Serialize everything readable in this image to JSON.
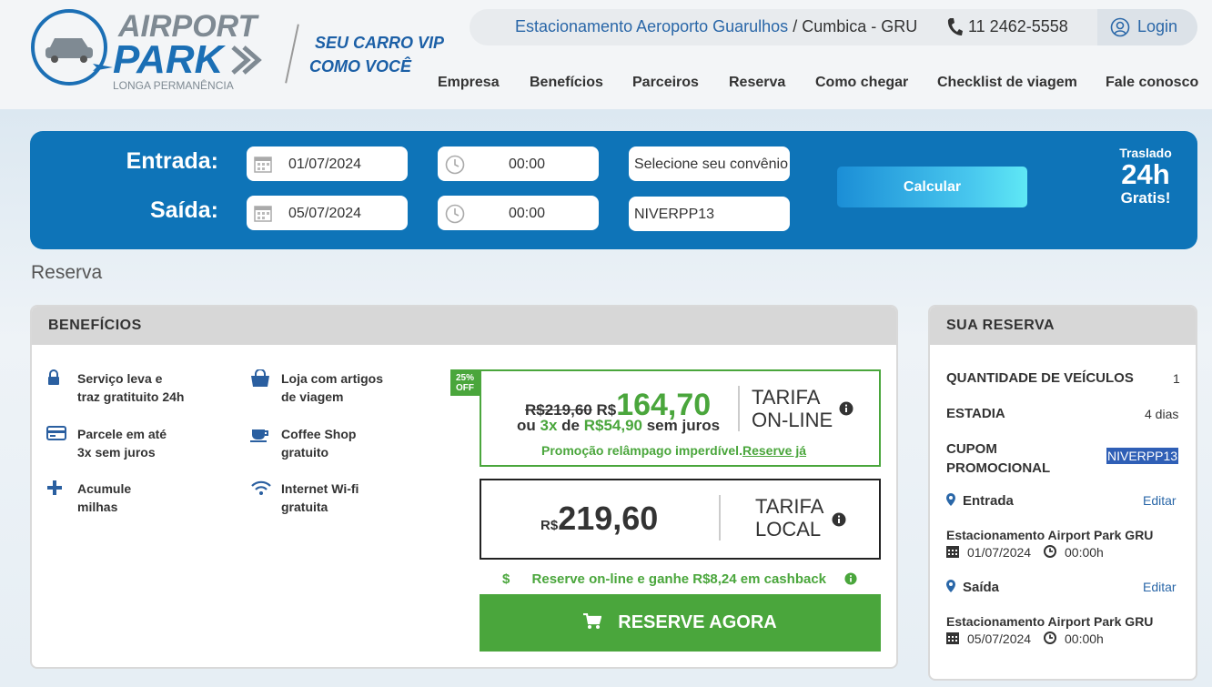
{
  "brand": {
    "logo_top": "AIRPORT",
    "logo_main": "PARK",
    "logo_sub": "LONGA PERMANÊNCIA",
    "slogan_line1": "SEU CARRO VIP",
    "slogan_line2": "COMO VOCÊ"
  },
  "topbar": {
    "location_link": "Estacionamento Aeroporto Guarulhos",
    "location_rest": " / Cumbica - GRU",
    "phone": "11 2462-5558",
    "login": "Login"
  },
  "nav": [
    "Empresa",
    "Benefícios",
    "Parceiros",
    "Reserva",
    "Como chegar",
    "Checklist de viagem",
    "Fale conosco"
  ],
  "form": {
    "entrada_label": "Entrada:",
    "saida_label": "Saída:",
    "entrada_date": "01/07/2024",
    "entrada_time": "00:00",
    "saida_date": "05/07/2024",
    "saida_time": "00:00",
    "convenio_placeholder": "Selecione seu convênio",
    "coupon": "NIVERPP13",
    "calc_button": "Calcular",
    "traslado_top": "Traslado",
    "traslado_mid": "24h",
    "traslado_bot": "Gratis!"
  },
  "page_title": "Reserva",
  "benefits": {
    "title": "BENEFÍCIOS",
    "items": [
      {
        "l1": "Serviço leva e",
        "l2": "traz gratituito 24h",
        "icon": "lock-icon"
      },
      {
        "l1": "Loja com artigos",
        "l2": "de viagem",
        "icon": "shopping-bag-icon"
      },
      {
        "l1": "Parcele em até",
        "l2": "3x sem juros",
        "icon": "credit-card-icon"
      },
      {
        "l1": "Coffee Shop",
        "l2": "gratuito",
        "icon": "coffee-cup-icon"
      },
      {
        "l1": "Acumule",
        "l2": "milhas",
        "icon": "plus-icon"
      },
      {
        "l1": "Internet Wi-fi",
        "l2": "gratuita",
        "icon": "wifi-icon"
      }
    ]
  },
  "online": {
    "badge_l1": "25%",
    "badge_l2": "OFF",
    "old_price": "R$219,60",
    "currency": "R$",
    "price": "164,70",
    "inst_pre": "ou ",
    "inst_n": "3x",
    "inst_mid": " de ",
    "inst_val": "R$54,90",
    "inst_post": " sem juros",
    "tarifa_l1": "TARIFA",
    "tarifa_l2": "ON-LINE",
    "promo": "Promoção relâmpago imperdível.",
    "promo_link": "Reserve já"
  },
  "local": {
    "currency": "R$",
    "price": "219,60",
    "tarifa_l1": "TARIFA",
    "tarifa_l2": "LOCAL"
  },
  "cashback": {
    "dollar": "$",
    "text": "Reserve on-line e ganhe R$8,24 em cashback"
  },
  "reserve_button": "RESERVE AGORA",
  "summary": {
    "title": "SUA RESERVA",
    "qty_label": "QUANTIDADE DE VEÍCULOS",
    "qty_value": "1",
    "stay_label": "ESTADIA",
    "stay_value": "4 dias",
    "coupon_l1": "CUPOM",
    "coupon_l2": "PROMOCIONAL",
    "coupon_value": "NIVERPP13",
    "entrada": "Entrada",
    "saida": "Saída",
    "edit": "Editar",
    "place": "Estacionamento Airport Park GRU",
    "entrada_date": "01/07/2024",
    "entrada_time": "00:00h",
    "saida_date": "05/07/2024",
    "saida_time": "00:00h"
  },
  "colors": {
    "primary": "#0e74b8",
    "green": "#4aa63c",
    "link": "#2a67a8"
  }
}
